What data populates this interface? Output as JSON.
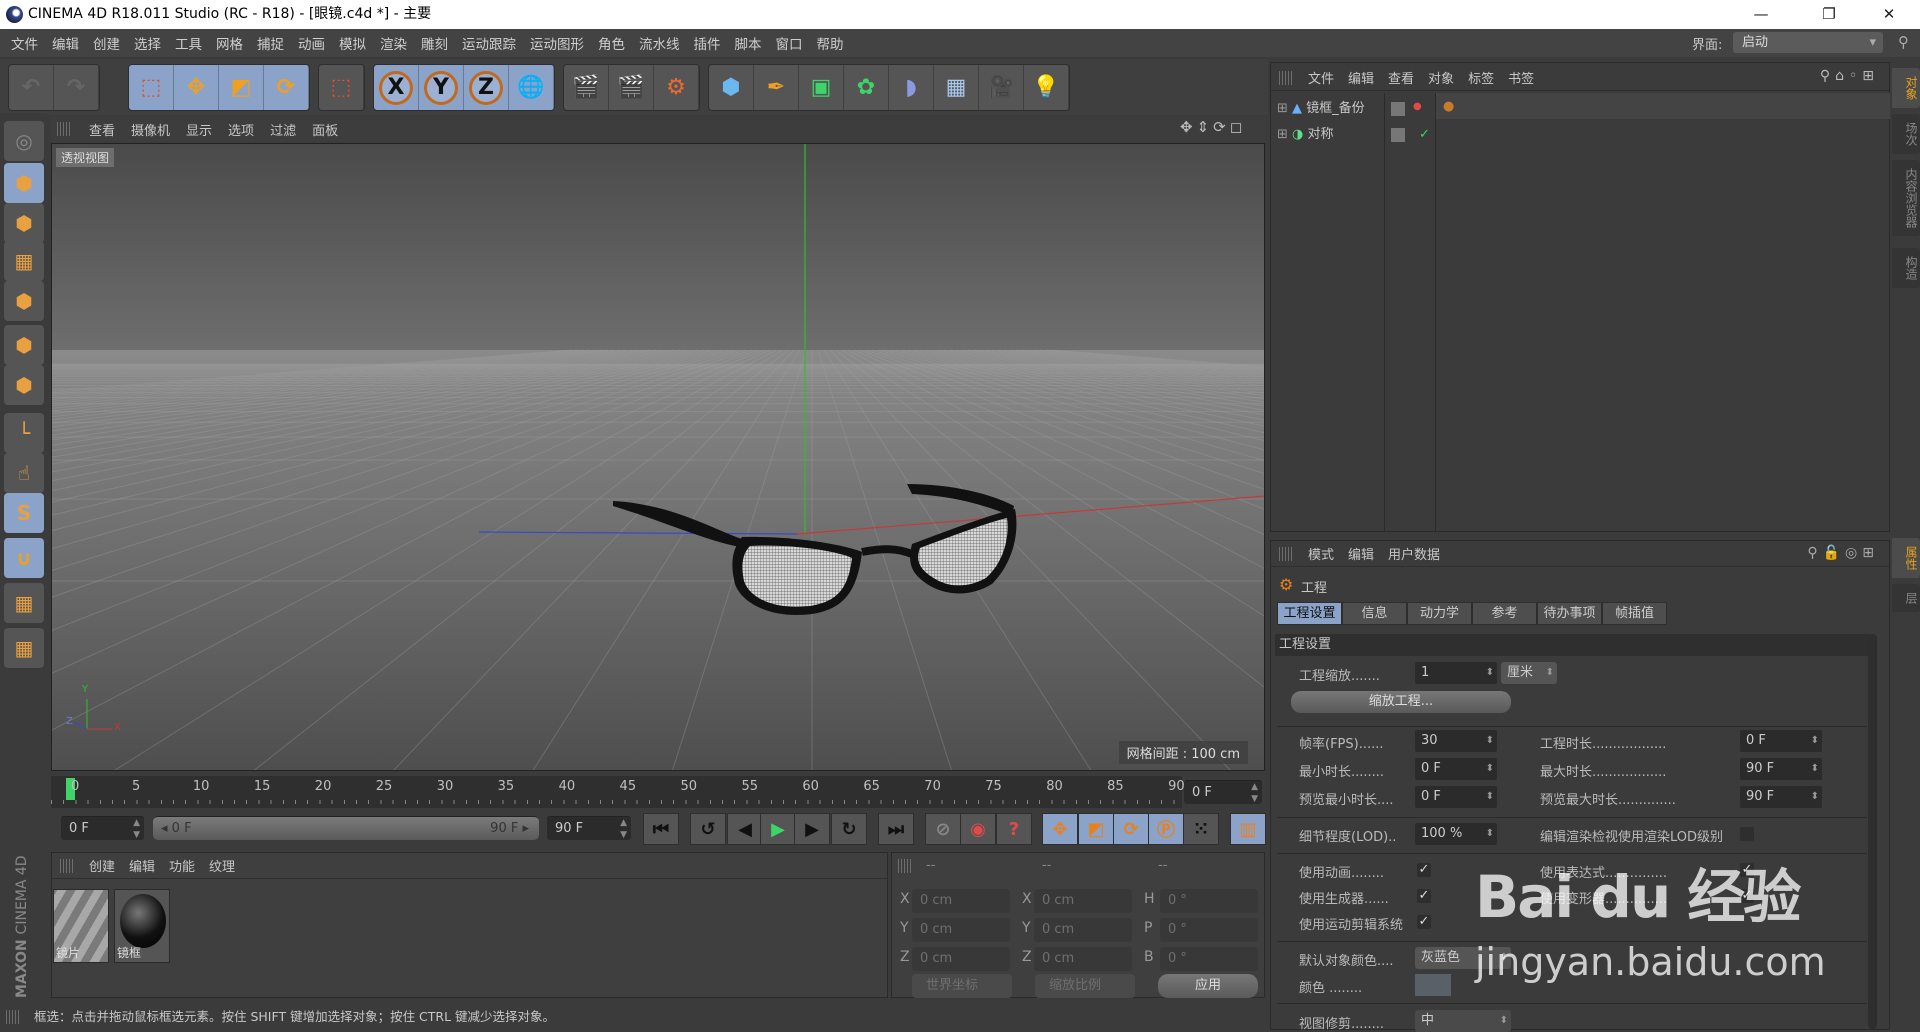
{
  "window": {
    "title": "CINEMA 4D R18.011 Studio (RC - R18) - [眼镜.c4d *] - 主要",
    "controls": [
      "minimize",
      "restore",
      "close"
    ]
  },
  "menubar": {
    "items": [
      "文件",
      "编辑",
      "创建",
      "选择",
      "工具",
      "网格",
      "捕捉",
      "动画",
      "模拟",
      "渲染",
      "雕刻",
      "运动跟踪",
      "运动图形",
      "角色",
      "流水线",
      "插件",
      "脚本",
      "窗口",
      "帮助"
    ],
    "layout_label": "界面:",
    "layout_value": "启动"
  },
  "toolbar": {
    "groups": [
      {
        "selected": false,
        "icons": [
          "undo-icon",
          "redo-icon"
        ]
      },
      {
        "selected": true,
        "icons": [
          "live-selection-icon",
          "move-icon",
          "scale-icon",
          "rotate-icon"
        ]
      },
      {
        "selected": false,
        "icons": [
          "recent-tool-icon"
        ]
      },
      {
        "selected": true,
        "icons": [
          "x-axis-lock-icon",
          "y-axis-lock-icon",
          "z-axis-lock-icon",
          "coordinate-system-icon"
        ]
      },
      {
        "selected": false,
        "icons": [
          "render-view-icon",
          "render-to-picture-viewer-icon",
          "render-settings-icon"
        ]
      },
      {
        "selected": false,
        "icons": [
          "cube-icon",
          "pen-icon",
          "subdivision-surface-icon",
          "cloner-icon",
          "bend-deformer-icon",
          "floor-icon",
          "camera-icon",
          "light-icon"
        ]
      }
    ]
  },
  "left_toolbar": [
    "make-editable-icon",
    "model-mode-icon",
    "texture-mode-icon",
    "workplane-icon",
    "points-mode-icon",
    "edges-mode-icon",
    "polygons-mode-icon",
    "axis-mode-icon",
    "tweak-mode-icon",
    "snap-icon",
    "magnet-icon",
    "lock-workplane-icon",
    "planar-workplane-icon"
  ],
  "viewport": {
    "menu": [
      "查看",
      "摄像机",
      "显示",
      "选项",
      "过滤",
      "面板"
    ],
    "name": "透视视图",
    "grid_spacing": "网格间距 : 100 cm",
    "axis_labels": {
      "x": "X",
      "y": "Y",
      "z": "Z"
    }
  },
  "timeline": {
    "ticks": [
      0,
      5,
      10,
      15,
      20,
      25,
      30,
      35,
      40,
      45,
      50,
      55,
      60,
      65,
      70,
      75,
      80,
      85,
      90
    ],
    "current_frame": 0,
    "current_frame_field": "0 F",
    "start_field": "0 F",
    "range_start": "0 F",
    "range_end": "90 F",
    "end_field": "90 F"
  },
  "transport": [
    "go-to-start-icon",
    "previous-key-icon",
    "previous-frame-icon",
    "play-icon",
    "next-frame-icon",
    "next-key-icon",
    "go-to-end-icon",
    "autokey-off-icon",
    "record-icon",
    "autokey-icon",
    "key-position-icon",
    "key-scale-icon",
    "key-rotation-icon",
    "key-parameter-icon",
    "key-point-level-icon",
    "timeline-icon"
  ],
  "materials": {
    "menu": [
      "创建",
      "编辑",
      "功能",
      "纹理"
    ],
    "items": [
      {
        "name": "镜片",
        "type": "striped"
      },
      {
        "name": "镜框",
        "type": "black-sphere"
      }
    ]
  },
  "coords": {
    "headers": [
      "--",
      "--",
      "--"
    ],
    "rows": [
      {
        "a": "X",
        "av": "0 cm",
        "b": "X",
        "bv": "0 cm",
        "c": "H",
        "cv": "0 °"
      },
      {
        "a": "Y",
        "av": "0 cm",
        "b": "Y",
        "bv": "0 cm",
        "c": "P",
        "cv": "0 °"
      },
      {
        "a": "Z",
        "av": "0 cm",
        "b": "Z",
        "bv": "0 cm",
        "c": "B",
        "cv": "0 °"
      }
    ],
    "world_dropdown": "世界坐标",
    "scale_dropdown": "缩放比例",
    "apply": "应用"
  },
  "statusbar": "框选：点击并拖动鼠标框选元素。按住 SHIFT 键增加选择对象；按住 CTRL 键减少选择对象。",
  "branding": {
    "line1": "MAXON",
    "line2": "CINEMA 4D"
  },
  "object_manager": {
    "menu": [
      "文件",
      "编辑",
      "查看",
      "对象",
      "标签",
      "书签"
    ],
    "objects": [
      {
        "name": "镜框_备份",
        "icon": "symmetry-null-icon",
        "render_dot": "#e24a4a"
      },
      {
        "name": "对称",
        "icon": "symmetry-icon",
        "enabled": true
      }
    ]
  },
  "attributes": {
    "menu": [
      "模式",
      "编辑",
      "用户数据"
    ],
    "object_title": "工程",
    "tabs": [
      "工程设置",
      "信息",
      "动力学",
      "参考",
      "待办事项",
      "帧插值"
    ],
    "active_tab": 0,
    "section": "工程设置",
    "project_scale_label": "工程缩放.......",
    "project_scale": "1",
    "project_unit": "厘米",
    "scale_project_button": "缩放工程...",
    "fps_label": "帧率(FPS)......",
    "fps": "30",
    "project_time_label": "工程时长..................",
    "project_time": "0 F",
    "min_time_label": "最小时长........",
    "min_time": "0 F",
    "max_time_label": "最大时长..................",
    "max_time": "90 F",
    "preview_min_label": "预览最小时长....",
    "preview_min": "0 F",
    "preview_max_label": "预览最大时长..............",
    "preview_max": "90 F",
    "lod_label": "细节程度(LOD)..",
    "lod": "100 %",
    "render_lod_label": "编辑渲染检视使用渲染LOD级别",
    "render_lod": false,
    "use_animation_label": "使用动画........",
    "use_animation": true,
    "use_expressions_label": "使用表达式...............",
    "use_expressions": true,
    "use_generators_label": "使用生成器......",
    "use_generators": true,
    "use_deformers_label": "使用变形器...............",
    "use_deformers": true,
    "use_motion_label": "使用运动剪辑系统",
    "use_motion": true,
    "default_color_label": "默认对象颜色....",
    "default_color": "灰蓝色",
    "color_label": "颜色 ........",
    "color_swatch": "#5a6068",
    "view_clip_label": "视图修剪........",
    "view_clip": "中"
  },
  "right_tabs": {
    "top": [
      "对象",
      "场次",
      "内容浏览器",
      "构造"
    ],
    "bottom": [
      "属性",
      "层"
    ]
  },
  "watermark": {
    "brand": "Bai du 经验",
    "url": "jingyan.baidu.com"
  },
  "colors": {
    "accent": "#8ba3c9",
    "orange": "#e8811d",
    "highlight_tab": "#e8a21d",
    "play": "#3ed46a"
  }
}
